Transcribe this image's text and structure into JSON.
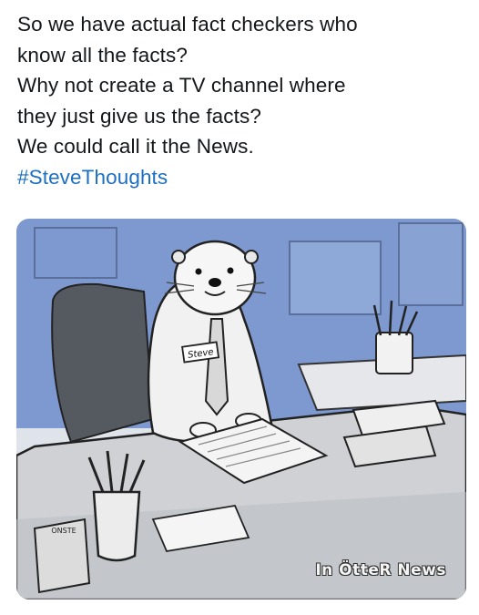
{
  "post": {
    "lines": [
      "So we have actual fact checkers who",
      "know all the facts?",
      "Why not create a TV channel where",
      "they just give us the facts?",
      "We could call it the News."
    ],
    "hashtag": "#SteveThoughts"
  },
  "image": {
    "name_tag": "Steve",
    "box_label": "ONSTE",
    "watermark": "In ÖtteR News",
    "colors": {
      "wall": "#7d99cf",
      "desk": "#cfd1d4",
      "link": "#1d6fc2"
    }
  }
}
